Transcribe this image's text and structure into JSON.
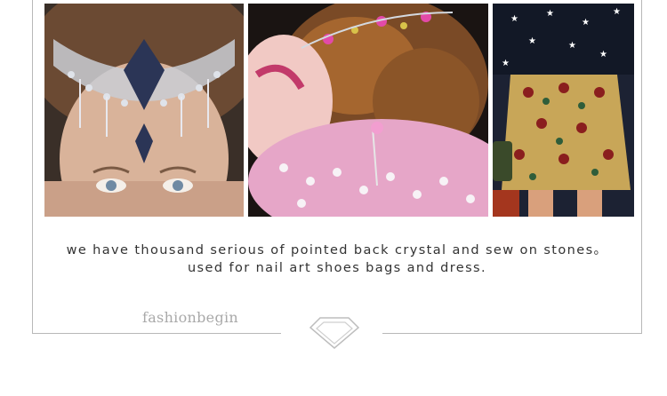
{
  "caption": {
    "line1": "we have thousand serious of pointed back crystal and sew on stones。",
    "line2": "used for nail art shoes bags and dress."
  },
  "brand": {
    "text": "fashionbegin"
  },
  "photos": [
    {
      "subject": "crystal-headpiece-model"
    },
    {
      "subject": "jeweled-hair-pin-model"
    },
    {
      "subject": "embellished-gold-skirt-model"
    }
  ],
  "icons": {
    "diamond": "diamond-icon"
  },
  "colors": {
    "border": "#b8b8b8",
    "caption": "#333333",
    "brand": "#a9a9a9"
  }
}
